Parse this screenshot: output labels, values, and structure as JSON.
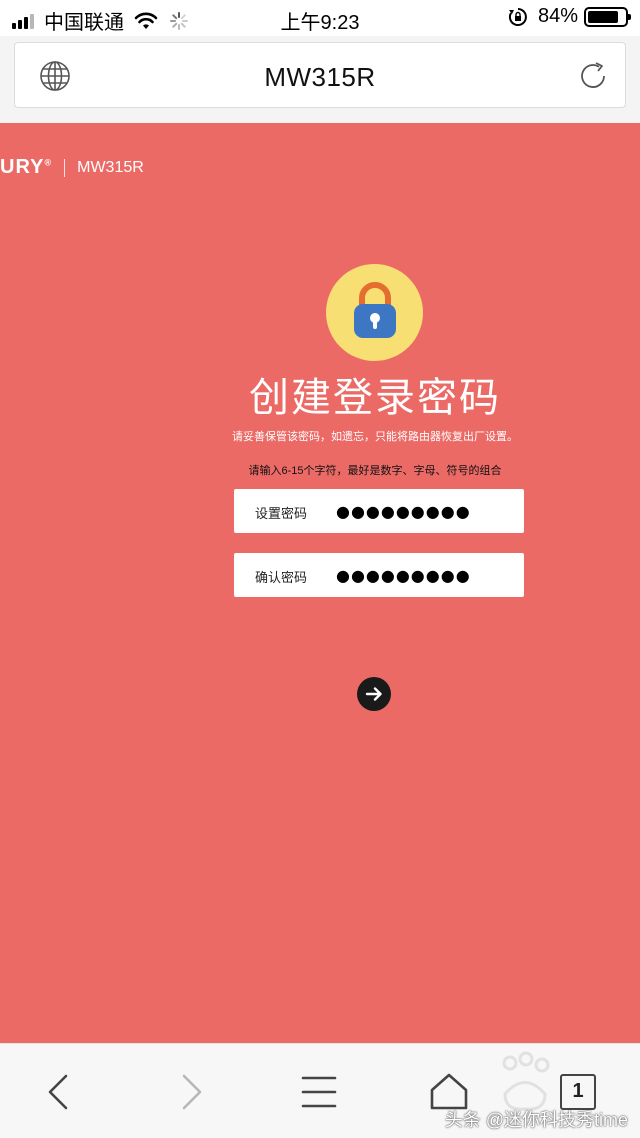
{
  "status_bar": {
    "carrier": "中国联通",
    "time": "上午9:23",
    "battery_percent": "84%",
    "battery_level": 0.84,
    "icons": [
      "signal-icon",
      "wifi-icon",
      "loading-icon",
      "rotation-lock-icon",
      "battery-icon"
    ]
  },
  "address_bar": {
    "title": "MW315R",
    "icons": [
      "globe-icon",
      "reload-icon"
    ]
  },
  "page": {
    "background_color": "#ec6a66",
    "brand_logo_text": "URY",
    "brand_logo_mark": "®",
    "brand_model": "MW315R",
    "title": "创建登录密码",
    "subtitle": "请妥善保管该密码，如遗忘，只能将路由器恢复出厂设置。",
    "hint": "请输入6-15个字符，最好是数字、字母、符号的组合",
    "password_field": {
      "label": "设置密码",
      "value": "●●●●●●●●●"
    },
    "confirm_field": {
      "label": "确认密码",
      "value": "●●●●●●●●●"
    },
    "icons": [
      "lock-icon",
      "arrow-right-icon"
    ]
  },
  "toolbar": {
    "tab_count": "1",
    "icons": [
      "back-icon",
      "forward-icon",
      "menu-icon",
      "home-icon",
      "tabs-icon"
    ]
  },
  "watermark": "头条 @迷你科技秀time"
}
